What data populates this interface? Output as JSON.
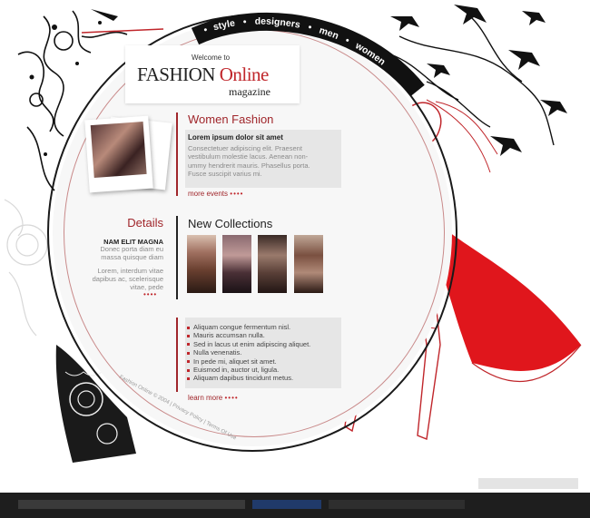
{
  "nav": {
    "items": [
      "style",
      "designers",
      "men",
      "women"
    ],
    "separator": "•"
  },
  "header": {
    "welcome": "Welcome to",
    "brand_main": "FASHION",
    "brand_accent": "Online",
    "brand_sub": "magazine"
  },
  "women_fashion": {
    "title": "Women Fashion",
    "heading": "Lorem ipsum dolor sit amet",
    "lines": [
      "Consectetuer adipiscing elit. Praesent",
      "vestibulum molestie lacus. Aenean non-",
      "ummy hendrerit mauris. Phasellus porta.",
      "Fusce suscipit varius mi."
    ],
    "more_label": "more events",
    "dots": "••••"
  },
  "details": {
    "title": "Details",
    "heading": "NAM ELIT MAGNA",
    "lines_a": [
      "Donec porta diam eu",
      "massa quisque diam"
    ],
    "lines_b": [
      "Lorem, interdum vitae",
      "dapibus ac, scelerisque",
      "vitae, pede"
    ],
    "dots": "••••"
  },
  "collections": {
    "title": "New Collections",
    "items": [
      "Aliquam congue fermentum nisl.",
      "Mauris accumsan nulla.",
      "Sed in lacus ut enim adipiscing aliquet.",
      "Nulla venenatis.",
      "In pede mi, aliquet sit amet.",
      "Euismod in, auctor ut, ligula.",
      "Aliquam dapibus tincidunt metus."
    ],
    "more_label": "learn more",
    "dots": "••••"
  },
  "footer": {
    "text": "Fashion Online © 2004 | Privacy Policy | Terms Of Use"
  },
  "colors": {
    "accent": "#c0262b",
    "dark": "#1a1a1a",
    "panel": "#e6e6e6"
  }
}
